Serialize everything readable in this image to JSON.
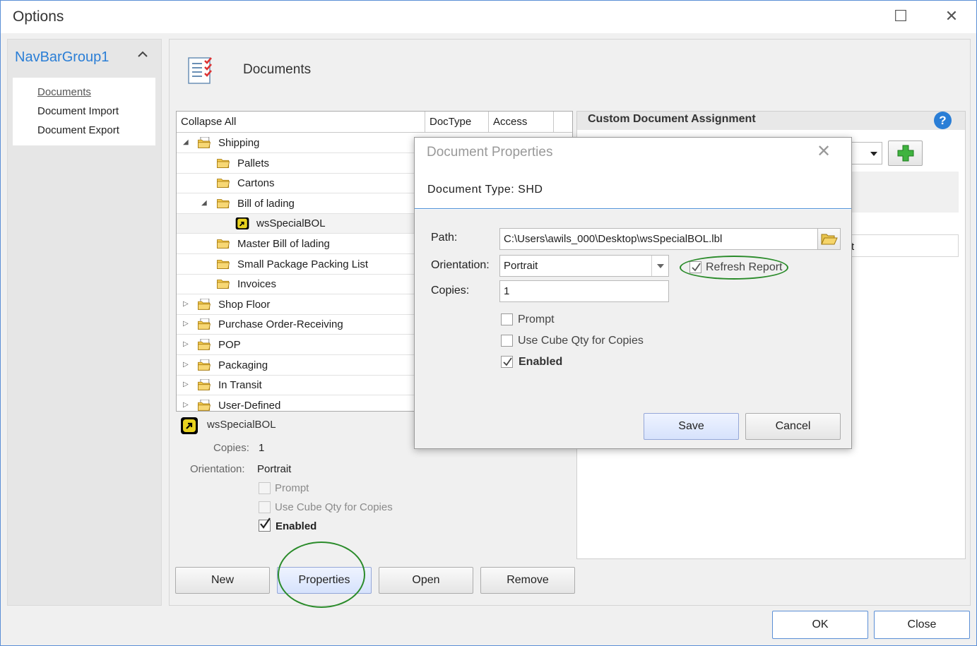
{
  "window": {
    "title": "Options",
    "maximize_glyph": "☐",
    "close_glyph": "✕"
  },
  "nav": {
    "group_title": "NavBarGroup1",
    "collapse_glyph": "^",
    "items": [
      {
        "label": "Documents"
      },
      {
        "label": "Document Import"
      },
      {
        "label": "Document Export"
      }
    ]
  },
  "main": {
    "title": "Documents",
    "tree": {
      "columns": [
        "Collapse All",
        "DocType",
        "Access"
      ],
      "rows": [
        {
          "label": "Shipping",
          "level": 0,
          "expander": "expanded"
        },
        {
          "label": "Pallets",
          "level": 1,
          "expander": "none"
        },
        {
          "label": "Cartons",
          "level": 1,
          "expander": "none"
        },
        {
          "label": "Bill of lading",
          "level": 1,
          "expander": "expanded"
        },
        {
          "label": "wsSpecialBOL",
          "level": 2,
          "expander": "none"
        },
        {
          "label": "Master Bill of lading",
          "level": 1,
          "expander": "none"
        },
        {
          "label": "Small Package Packing List",
          "level": 1,
          "expander": "none"
        },
        {
          "label": "Invoices",
          "level": 1,
          "expander": "none"
        },
        {
          "label": "Shop Floor",
          "level": 0,
          "expander": "collapsed"
        },
        {
          "label": "Purchase Order-Receiving",
          "level": 0,
          "expander": "collapsed"
        },
        {
          "label": "POP",
          "level": 0,
          "expander": "collapsed"
        },
        {
          "label": "Packaging",
          "level": 0,
          "expander": "collapsed"
        },
        {
          "label": "In Transit",
          "level": 0,
          "expander": "collapsed"
        },
        {
          "label": "User-Defined",
          "level": 0,
          "expander": "collapsed"
        }
      ]
    },
    "detail": {
      "name": "wsSpecialBOL",
      "copies_label": "Copies:",
      "copies_value": "1",
      "orientation_label": "Orientation:",
      "orientation_value": "Portrait",
      "prompt_label": "Prompt",
      "use_cube_label": "Use Cube Qty  for Copies",
      "enabled_label": "Enabled",
      "enabled_checked": true
    },
    "buttons": {
      "new": "New",
      "properties": "Properties",
      "open": "Open",
      "remove": "Remove"
    }
  },
  "right_panel": {
    "title": "Custom Document Assignment",
    "help_glyph": "?",
    "add_glyph": "+",
    "partial_text": "t"
  },
  "dialog": {
    "title": "Document Properties",
    "close_glyph": "✕",
    "doc_type": "Document Type: SHD",
    "path_label": "Path:",
    "path_value": "C:\\Users\\awils_000\\Desktop\\wsSpecialBOL.lbl",
    "orientation_label": "Orientation:",
    "orientation_value": "Portrait",
    "refresh_label": "Refresh Report",
    "refresh_checked": true,
    "copies_label": "Copies:",
    "copies_value": "1",
    "prompt_label": "Prompt",
    "use_cube_label": "Use Cube Qty for Copies",
    "enabled_label": "Enabled",
    "enabled_checked": true,
    "save_label": "Save",
    "cancel_label": "Cancel"
  },
  "footer": {
    "ok": "OK",
    "close": "Close"
  },
  "colors": {
    "accent": "#2a7ed6",
    "annotation": "#2a8b2a"
  }
}
